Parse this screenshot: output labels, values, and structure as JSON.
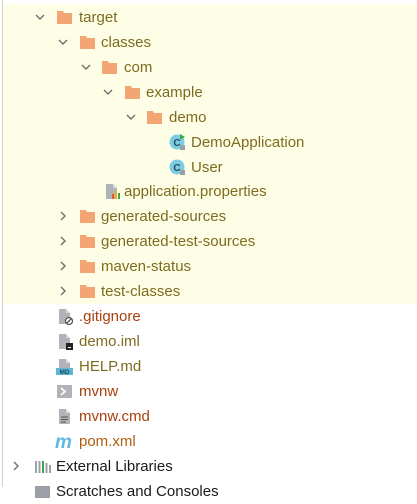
{
  "tree": {
    "target": "target",
    "classes": "classes",
    "com": "com",
    "example": "example",
    "demo": "demo",
    "demo_application": "DemoApplication",
    "user": "User",
    "application_properties": "application.properties",
    "generated_sources": "generated-sources",
    "generated_test_sources": "generated-test-sources",
    "maven_status": "maven-status",
    "test_classes": "test-classes",
    "gitignore": ".gitignore",
    "demo_iml": "demo.iml",
    "help_md": "HELP.md",
    "mvnw": "mvnw",
    "mvnw_cmd": "mvnw.cmd",
    "pom_xml": "pom.xml",
    "external_libraries": "External Libraries",
    "scratches": "Scratches and Consoles"
  },
  "colors": {
    "excluded_bg": "#fefee6",
    "folder": "#f4a574",
    "class_icon": "#7ccde4",
    "olive_text": "#7d6b1f",
    "ignored_text": "#a8400e"
  },
  "icons": {
    "md_badge": "MD",
    "maven": "m",
    "class": "C"
  }
}
